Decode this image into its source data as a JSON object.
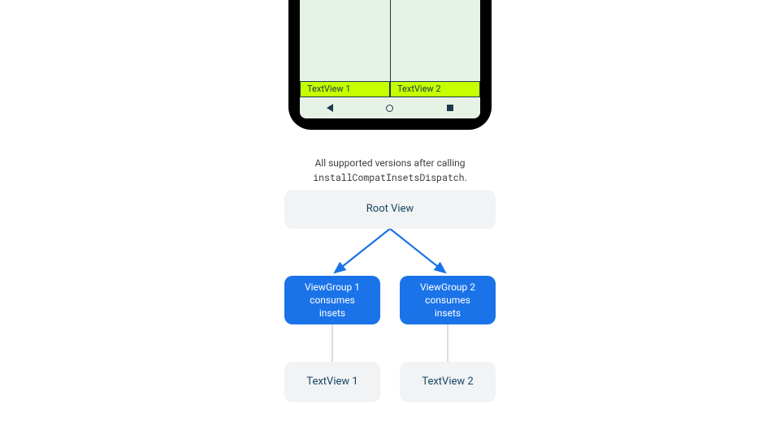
{
  "phone": {
    "textview1": "TextView 1",
    "textview2": "TextView 2"
  },
  "caption": {
    "line1": "All supported versions after calling",
    "code": "installCompatInsetsDispatch",
    "suffix": "."
  },
  "diagram": {
    "root": "Root View",
    "vg1": "ViewGroup 1\nconsumes\ninsets",
    "vg2": "ViewGroup 2\nconsumes\ninsets",
    "tv1": "TextView 1",
    "tv2": "TextView 2"
  },
  "colors": {
    "blue": "#1a73e8",
    "grey": "#f1f3f4",
    "edge_light": "#dadce0"
  }
}
